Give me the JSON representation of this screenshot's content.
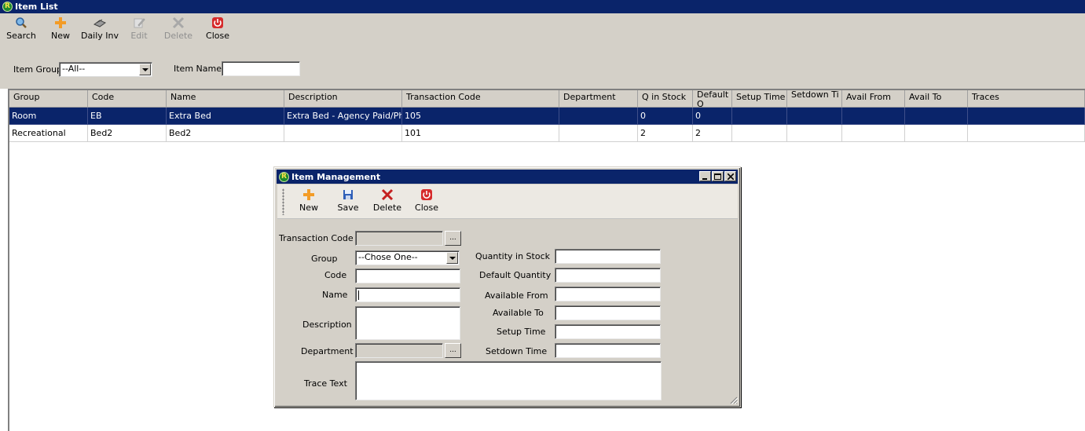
{
  "window": {
    "title": "Item List",
    "app_icon_letter": "R"
  },
  "toolbar": {
    "search": "Search",
    "new": "New",
    "daily_inv": "Daily Inv",
    "edit": "Edit",
    "delete": "Delete",
    "close": "Close"
  },
  "filters": {
    "item_group_label": "Item Group",
    "item_group_value": "--All--",
    "item_name_label": "Item Name",
    "item_name_value": ""
  },
  "grid": {
    "columns": [
      "Group",
      "Code",
      "Name",
      "Description",
      "Transaction Code",
      "Department",
      "Q in Stock",
      "Default Q",
      "Setup Time",
      "Setdown Ti",
      "Avail From",
      "Avail To",
      "Traces"
    ],
    "rows": [
      [
        "Room",
        "EB",
        "Extra Bed",
        "Extra Bed - Agency Paid/Ph...",
        "105",
        "",
        "0",
        "0",
        "",
        "",
        "",
        "",
        ""
      ],
      [
        "Recreational",
        "Bed2",
        "Bed2",
        "",
        "101",
        "",
        "2",
        "2",
        "",
        "",
        "",
        "",
        ""
      ]
    ],
    "selected_row": 0
  },
  "dialog": {
    "title": "Item Management",
    "toolbar": {
      "new": "New",
      "save": "Save",
      "delete": "Delete",
      "close": "Close"
    },
    "labels": {
      "transaction_code": "Transaction Code",
      "group": "Group",
      "code": "Code",
      "name": "Name",
      "description": "Description",
      "department": "Department",
      "trace_text": "Trace Text",
      "quantity_in_stock": "Quantity in Stock",
      "default_quantity": "Default Quantity",
      "available_from": "Available From",
      "available_to": "Available To",
      "setup_time": "Setup Time",
      "setdown_time": "Setdown Time"
    },
    "values": {
      "group": "--Chose One--",
      "ellipsis": "..."
    }
  }
}
